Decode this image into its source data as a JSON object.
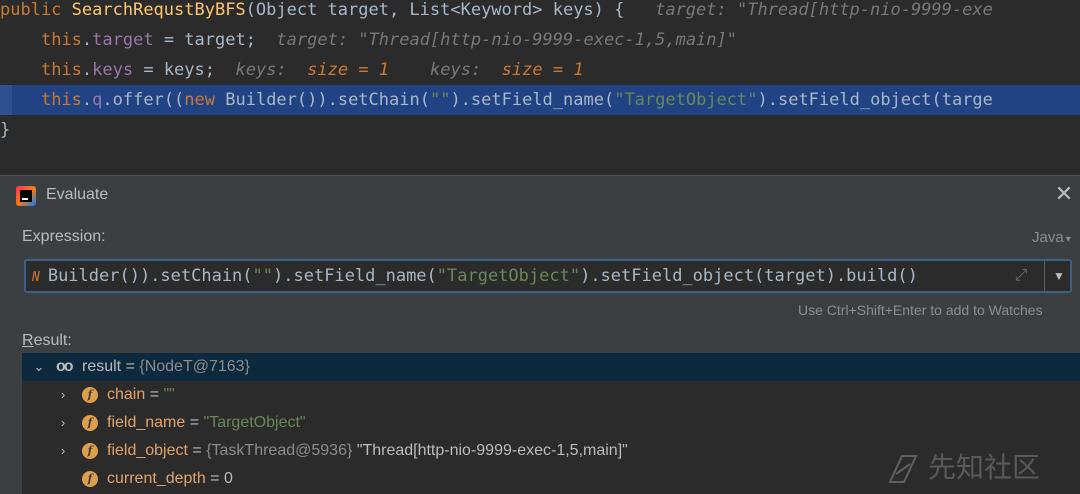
{
  "editor": {
    "line1": {
      "kw_public": "public",
      "method_name": "SearchRequstByBFS",
      "params": "(Object target, List<Keyword> keys) {",
      "hint": "target: \"Thread[http-nio-9999-exe"
    },
    "line2": {
      "kw_this": "this",
      "dot": ".",
      "field": "target",
      "rest": " = target;",
      "hint": "target: \"Thread[http-nio-9999-exec-1,5,main]\""
    },
    "line3": {
      "kw_this": "this",
      "dot": ".",
      "field": "keys",
      "rest": " = keys;",
      "hint1_label": "keys:",
      "hint1_value": "size = 1",
      "hint2_label": "keys:",
      "hint2_value": "size = 1"
    },
    "line4": {
      "kw_this": "this",
      "dot": ".",
      "field": "q",
      "call": ".offer((",
      "kw_new": "new",
      "builder": " Builder()).setChain(",
      "chain_str": "\"\"",
      "mid": ").setField_name(",
      "name_str": "\"TargetObject\"",
      "tail": ").setField_object(targe"
    },
    "line5": "}"
  },
  "dialog": {
    "title": "Evaluate",
    "close_glyph": "✕",
    "expression_label": "Expression:",
    "language": "Java",
    "expression": {
      "prefix": "N",
      "part1": "Builder()).setChain(",
      "str1": "\"\"",
      "part2": ").setField_name(",
      "str2": "\"TargetObject\"",
      "part3": ").setField_object(target).build()"
    },
    "watch_hint": "Use Ctrl+Shift+Enter to add to Watches",
    "result_label": "Result:",
    "result_label_mnemonic": "R",
    "result_label_rest": "esult:"
  },
  "result_tree": [
    {
      "name": "result",
      "eq": " = ",
      "ref": "{NodeT@7163}",
      "value": "",
      "expanded": true,
      "icon": "watch-icon"
    },
    {
      "name": "chain",
      "eq": " = ",
      "ref": "",
      "value": "\"\"",
      "expanded": false,
      "icon": "field-icon"
    },
    {
      "name": "field_name",
      "eq": " = ",
      "ref": "",
      "value": "\"TargetObject\"",
      "expanded": false,
      "icon": "field-icon"
    },
    {
      "name": "field_object",
      "eq": " = ",
      "ref": "{TaskThread@5936}",
      "value": " \"Thread[http-nio-9999-exec-1,5,main]\"",
      "expanded": false,
      "icon": "field-icon"
    },
    {
      "name": "current_depth",
      "eq": " = ",
      "ref": "",
      "value": "0",
      "expanded": false,
      "icon": "field-icon"
    }
  ],
  "icons": {
    "field_glyph": "f",
    "watch_glyph": "oo",
    "arrow_expanded": "⌄",
    "arrow_collapsed": "›",
    "expand_glyph": "⤢",
    "dropdown_glyph": "▼"
  },
  "watermark": {
    "text": "先知社区"
  },
  "colors": {
    "editor_bg": "#2b2b2b",
    "dialog_bg": "#3c3f41",
    "selection": "#214283",
    "keyword": "#cc7832",
    "method": "#ffc66d",
    "field": "#9876aa",
    "string": "#6a8759"
  }
}
